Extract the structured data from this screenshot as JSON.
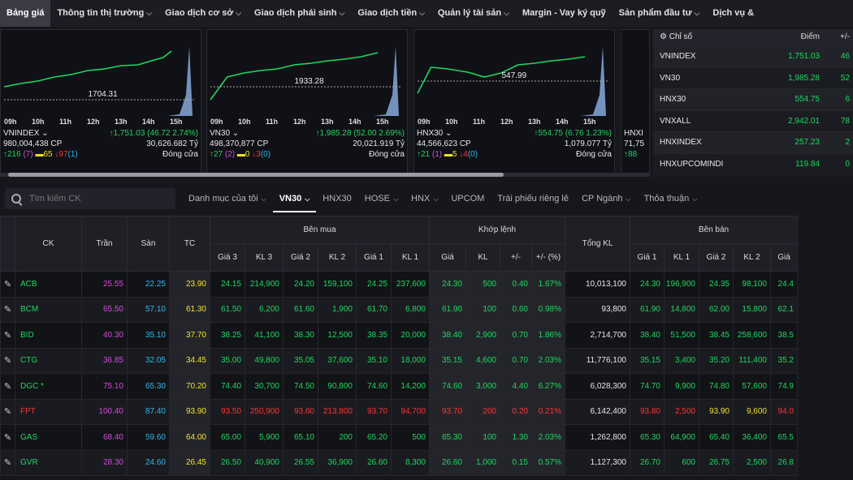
{
  "nav": [
    {
      "label": "Bảng giá",
      "active": true,
      "dropdown": false
    },
    {
      "label": "Thông tin thị trường",
      "dropdown": true
    },
    {
      "label": "Giao dịch cơ sở",
      "dropdown": true
    },
    {
      "label": "Giao dịch phái sinh",
      "dropdown": true
    },
    {
      "label": "Giao dịch tiền",
      "dropdown": true
    },
    {
      "label": "Quản lý tài sản",
      "dropdown": true
    },
    {
      "label": "Margin - Vay ký quỹ",
      "dropdown": false
    },
    {
      "label": "Sản phẩm đầu tư",
      "dropdown": true
    },
    {
      "label": "Dịch vụ &",
      "dropdown": false
    }
  ],
  "chart_data": [
    {
      "type": "line",
      "title": "VNINDEX",
      "x": [
        "09h",
        "10h",
        "11h",
        "12h",
        "13h",
        "14h",
        "15h"
      ],
      "ref_label": "1704.31"
    },
    {
      "type": "line",
      "title": "VN30",
      "x": [
        "09h",
        "10h",
        "11h",
        "12h",
        "13h",
        "14h",
        "15h"
      ],
      "ref_label": "1933.28"
    },
    {
      "type": "line",
      "title": "HNX30",
      "x": [
        "09h",
        "10h",
        "11h",
        "12h",
        "13h",
        "14h",
        "15h"
      ],
      "ref_label": "547.99"
    }
  ],
  "chart_cards": [
    {
      "name": "VNINDEX ⌄",
      "change": "↑1,751.03 (46.72 2.74%)",
      "volume": "980,004,438 CP",
      "value": "30,626.682 Tỷ",
      "up": "↑216",
      "up_ceil": "(7)",
      "ref": "▬65",
      "down": "↓97",
      "down_floor": "(1)",
      "status": "Đóng cửa"
    },
    {
      "name": "VN30 ⌄",
      "change": "↑1,985.28 (52.00 2.69%)",
      "volume": "498,370,877 CP",
      "value": "20,021.919 Tỷ",
      "up": "↑27",
      "up_ceil": "(2)",
      "ref": "▬0",
      "down": "↓3",
      "down_floor": "(0)",
      "status": "Đóng cửa"
    },
    {
      "name": "HNX30 ⌄",
      "change": "↑554.75 (6.76 1.23%)",
      "volume": "44,566,623 CP",
      "value": "1,079.077 Tỷ",
      "up": "↑21",
      "up_ceil": "(1)",
      "ref": "▬5",
      "down": "↓4",
      "down_floor": "(0)",
      "status": "Đóng cửa"
    },
    {
      "name": "HNXI",
      "volume": "71,75",
      "up": "↑88"
    }
  ],
  "index_panel": {
    "headers": [
      "Chỉ số",
      "Điểm",
      "+/-"
    ],
    "rows": [
      {
        "name": "VNINDEX",
        "value": "1,751.03",
        "change": "46"
      },
      {
        "name": "VN30",
        "value": "1,985.28",
        "change": "52"
      },
      {
        "name": "HNX30",
        "value": "554.75",
        "change": "6"
      },
      {
        "name": "VNXALL",
        "value": "2,942.01",
        "change": "78"
      },
      {
        "name": "HNXINDEX",
        "value": "257.23",
        "change": "2"
      },
      {
        "name": "HNXUPCOMINDI",
        "value": "119.84",
        "change": "0"
      }
    ]
  },
  "filter": {
    "search_placeholder": "Tìm kiếm CK",
    "tabs": [
      {
        "label": "Danh mục của tôi",
        "dropdown": true
      },
      {
        "label": "VN30",
        "dropdown": true,
        "active": true
      },
      {
        "label": "HNX30",
        "dropdown": false
      },
      {
        "label": "HOSE",
        "dropdown": true
      },
      {
        "label": "HNX",
        "dropdown": true
      },
      {
        "label": "UPCOM",
        "dropdown": false
      },
      {
        "label": "Trái phiếu riêng lẻ",
        "dropdown": false
      },
      {
        "label": "CP Ngành",
        "dropdown": true
      },
      {
        "label": "Thỏa thuận",
        "dropdown": true
      }
    ]
  },
  "table": {
    "group_headers": {
      "ck": "CK",
      "tran": "Trần",
      "san": "Sàn",
      "tc": "TC",
      "ben_mua": "Bên mua",
      "khop_lenh": "Khớp lệnh",
      "tong_kl": "Tổng KL",
      "ben_ban": "Bên bán"
    },
    "sub_headers": [
      "Giá 3",
      "KL 3",
      "Giá 2",
      "KL 2",
      "Giá 1",
      "KL 1",
      "Giá",
      "KL",
      "+/-",
      "+/- (%)",
      "Giá 1",
      "KL 1",
      "Giá 2",
      "KL 2",
      "Giá"
    ],
    "rows": [
      {
        "ck": "ACB",
        "tran": "25.55",
        "san": "22.25",
        "tc": "23.90",
        "b3": "24.15",
        "bk3": "214,900",
        "b2": "24.20",
        "bk2": "159,100",
        "b1": "24.25",
        "bk1": "237,600",
        "gia": "24.30",
        "kl": "500",
        "chg": "0.40",
        "pct": "1.67%",
        "tong": "10,013,100",
        "s1": "24.30",
        "sk1": "196,900",
        "s2": "24.35",
        "sk2": "98,100",
        "s3": "24.4",
        "c": "up",
        "s2c": "up"
      },
      {
        "ck": "BCM",
        "tran": "65.50",
        "san": "57.10",
        "tc": "61.30",
        "b3": "61.50",
        "bk3": "6,200",
        "b2": "61.60",
        "bk2": "1,900",
        "b1": "61.70",
        "bk1": "6,800",
        "gia": "61.90",
        "kl": "100",
        "chg": "0.60",
        "pct": "0.98%",
        "tong": "93,800",
        "s1": "61.90",
        "sk1": "14,800",
        "s2": "62.00",
        "sk2": "15,800",
        "s3": "62.1",
        "c": "up",
        "s2c": "up"
      },
      {
        "ck": "BID",
        "tran": "40.30",
        "san": "35.10",
        "tc": "37.70",
        "b3": "38.25",
        "bk3": "41,100",
        "b2": "38.30",
        "bk2": "12,500",
        "b1": "38.35",
        "bk1": "20,000",
        "gia": "38.40",
        "kl": "2,900",
        "chg": "0.70",
        "pct": "1.86%",
        "tong": "2,714,700",
        "s1": "38.40",
        "sk1": "51,500",
        "s2": "38.45",
        "sk2": "258,600",
        "s3": "38.5",
        "c": "up",
        "s2c": "up"
      },
      {
        "ck": "CTG",
        "tran": "36.85",
        "san": "32.05",
        "tc": "34.45",
        "b3": "35.00",
        "bk3": "49,800",
        "b2": "35.05",
        "bk2": "37,600",
        "b1": "35.10",
        "bk1": "18,000",
        "gia": "35.15",
        "kl": "4,600",
        "chg": "0.70",
        "pct": "2.03%",
        "tong": "11,776,100",
        "s1": "35.15",
        "sk1": "3,400",
        "s2": "35.20",
        "sk2": "111,400",
        "s3": "35.2",
        "c": "up",
        "s2c": "up"
      },
      {
        "ck": "DGC *",
        "tran": "75.10",
        "san": "65.30",
        "tc": "70.20",
        "b3": "74.40",
        "bk3": "30,700",
        "b2": "74.50",
        "bk2": "90,800",
        "b1": "74.60",
        "bk1": "14,200",
        "gia": "74.60",
        "kl": "3,000",
        "chg": "4.40",
        "pct": "6.27%",
        "tong": "6,028,300",
        "s1": "74.70",
        "sk1": "9,900",
        "s2": "74.80",
        "sk2": "57,600",
        "s3": "74.9",
        "c": "up",
        "s2c": "up"
      },
      {
        "ck": "FPT",
        "tran": "100.40",
        "san": "87.40",
        "tc": "93.90",
        "b3": "93.50",
        "bk3": "250,900",
        "b2": "93.60",
        "bk2": "213,800",
        "b1": "93.70",
        "bk1": "94,700",
        "gia": "93.70",
        "kl": "200",
        "chg": "0.20",
        "pct": "0.21%",
        "tong": "6,142,400",
        "s1": "93.80",
        "sk1": "2,500",
        "s2": "93.90",
        "sk2": "9,600",
        "s3": "94.0",
        "c": "down",
        "s2c": "ref"
      },
      {
        "ck": "GAS",
        "tran": "68.40",
        "san": "59.60",
        "tc": "64.00",
        "b3": "65.00",
        "bk3": "5,900",
        "b2": "65.10",
        "bk2": "200",
        "b1": "65.20",
        "bk1": "500",
        "gia": "65.30",
        "kl": "100",
        "chg": "1.30",
        "pct": "2.03%",
        "tong": "1,262,800",
        "s1": "65.30",
        "sk1": "64,900",
        "s2": "65.40",
        "sk2": "36,400",
        "s3": "65.5",
        "c": "up",
        "s2c": "up"
      },
      {
        "ck": "GVR",
        "tran": "28.30",
        "san": "24.60",
        "tc": "26.45",
        "b3": "26.50",
        "bk3": "40,900",
        "b2": "26.55",
        "bk2": "36,900",
        "b1": "26.60",
        "bk1": "8,300",
        "gia": "26.60",
        "kl": "1,000",
        "chg": "0.15",
        "pct": "0.57%",
        "tong": "1,127,300",
        "s1": "26.70",
        "sk1": "600",
        "s2": "26.75",
        "sk2": "2,500",
        "s3": "26.8",
        "c": "up",
        "s2c": "up"
      }
    ]
  },
  "colors": {
    "up": "#1ed760",
    "down": "#ff3333",
    "ref": "#f3e22b",
    "ceil": "#d34bd9",
    "floor": "#2fb8e8",
    "bg": "#16171c"
  }
}
